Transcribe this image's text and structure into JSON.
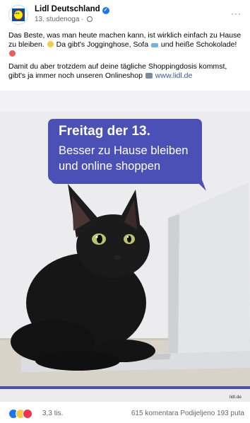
{
  "post": {
    "page_name": "Lidl Deutschland",
    "date": "13. studenoga",
    "separator": "·",
    "logo_text": "LiDL",
    "more_label": "···",
    "text_line1": "Das Beste, was man heute machen kann, ist wirklich einfach zu Hause zu bleiben.",
    "text_line1b": "Da gibt's Jogginghose, Sofa",
    "text_line1c": "und heiße Schokolade!",
    "text_line2": "Damit du aber trotzdem auf deine tägliche Shoppingdosis kommst, gibt's ja immer noch unseren Onlineshop",
    "link": "www.lidl.de"
  },
  "image": {
    "title": "Freitag der 13.",
    "line2": "Besser zu Hause bleiben",
    "line3": "und online shoppen",
    "brand": "lidl.de",
    "colors": {
      "bubble": "#4a50b5",
      "background": "#ecebed"
    }
  },
  "reactions": {
    "count": "3,3 tis.",
    "comments": "615 komentara",
    "shares": "Podijeljeno 193 puta",
    "icons": [
      "like-icon",
      "haha-icon",
      "love-icon"
    ]
  }
}
